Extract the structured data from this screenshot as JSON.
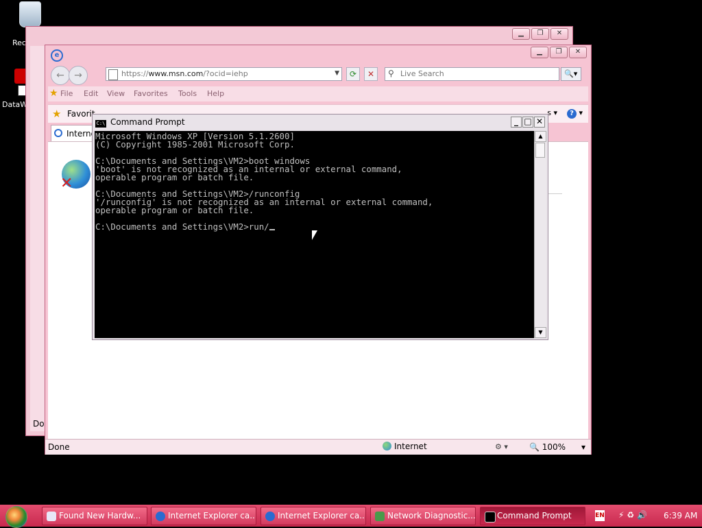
{
  "desktop": {
    "icons": [
      {
        "label": "Rec"
      },
      {
        "label": "DataW"
      }
    ]
  },
  "ie_back": {
    "status": "Don"
  },
  "ie": {
    "address": {
      "scheme": "https://",
      "host": "www.msn.com",
      "path": "/?ocid=iehp"
    },
    "search_placeholder": "Live Search",
    "menu": [
      "File",
      "Edit",
      "View",
      "Favorites",
      "Tools",
      "Help"
    ],
    "favorites_label": "Favorit",
    "toolbar_right": "s",
    "tab_label": "Interne",
    "status": {
      "text": "Done",
      "zone": "Internet",
      "zoom": "100%"
    }
  },
  "cmd": {
    "title": "Command Prompt",
    "lines": [
      "Microsoft Windows XP [Version 5.1.2600]",
      "(C) Copyright 1985-2001 Microsoft Corp.",
      "",
      "C:\\Documents and Settings\\VM2>boot windows",
      "'boot' is not recognized as an internal or external command,",
      "operable program or batch file.",
      "",
      "C:\\Documents and Settings\\VM2>/runconfig",
      "'/runconfig' is not recognized as an internal or external command,",
      "operable program or batch file.",
      "",
      "C:\\Documents and Settings\\VM2>run/"
    ]
  },
  "taskbar": {
    "buttons": [
      {
        "label": "Found New Hardw...",
        "icon": "hardware-icon",
        "color": "#e8e8f8"
      },
      {
        "label": "Internet Explorer ca...",
        "icon": "ie-icon",
        "color": "#2a6bd0"
      },
      {
        "label": "Internet Explorer ca...",
        "icon": "ie-icon",
        "color": "#2a6bd0"
      },
      {
        "label": "Network Diagnostic...",
        "icon": "network-icon",
        "color": "#4a9a4a"
      },
      {
        "label": "Command Prompt",
        "icon": "cmd-icon",
        "color": "#000000"
      }
    ],
    "lang": "EN",
    "clock": "6:39 AM"
  }
}
